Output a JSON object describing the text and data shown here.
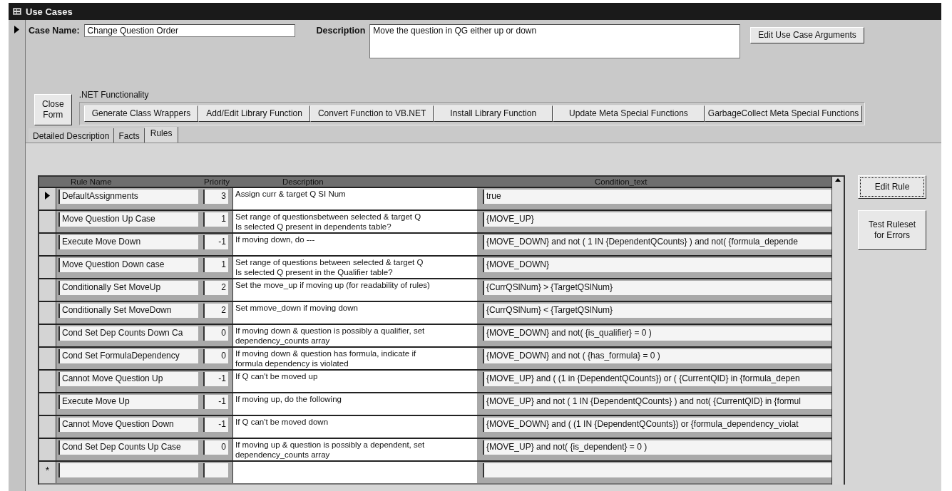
{
  "window": {
    "title": "Use Cases"
  },
  "record": {
    "current": true
  },
  "case_name": {
    "label": "Case Name:",
    "value": "Change Question Order"
  },
  "description": {
    "label": "Description",
    "value": "Move the question in QG either up or down"
  },
  "edit_arguments_button": "Edit Use Case Arguments",
  "close_button": "Close\nForm",
  "net_group": {
    "title": ".NET Functionality",
    "buttons": [
      "Generate Class Wrappers",
      "Add/Edit Library Function",
      "Convert Function to VB.NET",
      "Install Library Function",
      "Update Meta Special Functions",
      "GarbageCollect Meta Special Functions"
    ]
  },
  "tabs": [
    {
      "label": "Detailed Description",
      "selected": false
    },
    {
      "label": "Facts",
      "selected": false
    },
    {
      "label": "Rules",
      "selected": true
    }
  ],
  "rules_table": {
    "columns": [
      "Rule Name",
      "Priority",
      "Description",
      "Condition_text"
    ],
    "rows": [
      {
        "current": true,
        "name": "DefaultAssignments",
        "priority": "3",
        "description": "Assign curr & target Q SI Num",
        "condition": "true"
      },
      {
        "current": false,
        "name": "Move Question Up Case",
        "priority": "1",
        "description": "Set range of questionsbetween selected & target Q\nIs selected Q present in dependents table?",
        "condition": "{MOVE_UP}"
      },
      {
        "current": false,
        "name": "Execute Move Down",
        "priority": "-1",
        "description": "If moving down, do ---",
        "condition": "{MOVE_DOWN} and not ( 1 IN {DependentQCounts} ) and not( {formula_depende"
      },
      {
        "current": false,
        "name": "Move Question Down case",
        "priority": "1",
        "description": "Set range of questions between selected & target Q\nIs selected Q present in the Qualifier table?",
        "condition": "{MOVE_DOWN}"
      },
      {
        "current": false,
        "name": "Conditionally Set MoveUp",
        "priority": "2",
        "description": "Set the move_up if moving up (for readability of rules)",
        "condition": " {CurrQSlNum} > {TargetQSlNum}"
      },
      {
        "current": false,
        "name": "Conditionally Set MoveDown",
        "priority": "2",
        "description": "Set mmove_down if moving down",
        "condition": " {CurrQSlNum} < {TargetQSlNum}"
      },
      {
        "current": false,
        "name": "Cond Set Dep Counts Down Ca",
        "priority": "0",
        "description": "If moving down & question is possibly a qualifier, set\ndependency_counts array",
        "condition": "{MOVE_DOWN} and not( {is_qualifier} = 0 )"
      },
      {
        "current": false,
        "name": "Cond Set FormulaDependency",
        "priority": "0",
        "description": "If moving down & question has formula, indicate if\nformula dependency is violated",
        "condition": "{MOVE_DOWN} and not ( {has_formula} = 0 )"
      },
      {
        "current": false,
        "name": "Cannot Move Question Up",
        "priority": "-1",
        "description": "If Q can't be moved up",
        "condition": "{MOVE_UP} and ( (1 in {DependentQCounts}) or ( {CurrentQID} in {formula_depen"
      },
      {
        "current": false,
        "name": "Execute Move Up",
        "priority": "-1",
        "description": "If moving up, do the following",
        "condition": "{MOVE_UP} and not ( 1 IN {DependentQCounts} ) and not( {CurrentQID} in {formul"
      },
      {
        "current": false,
        "name": "Cannot Move Question Down",
        "priority": "-1",
        "description": "If Q can't be moved down",
        "condition": "{MOVE_DOWN} and ( (1 IN {DependentQCounts}) or {formula_dependency_violat"
      },
      {
        "current": false,
        "name": "Cond Set Dep Counts Up Case",
        "priority": "0",
        "description": "If moving up & question is possibly a dependent, set\ndependency_counts array",
        "condition": "{MOVE_UP} and not( {is_dependent} = 0 )"
      }
    ],
    "new_row_marker": "*"
  },
  "side_buttons": [
    {
      "label": "Edit Rule",
      "focused": true
    },
    {
      "label": "Test Ruleset\nfor Errors",
      "focused": false
    }
  ]
}
